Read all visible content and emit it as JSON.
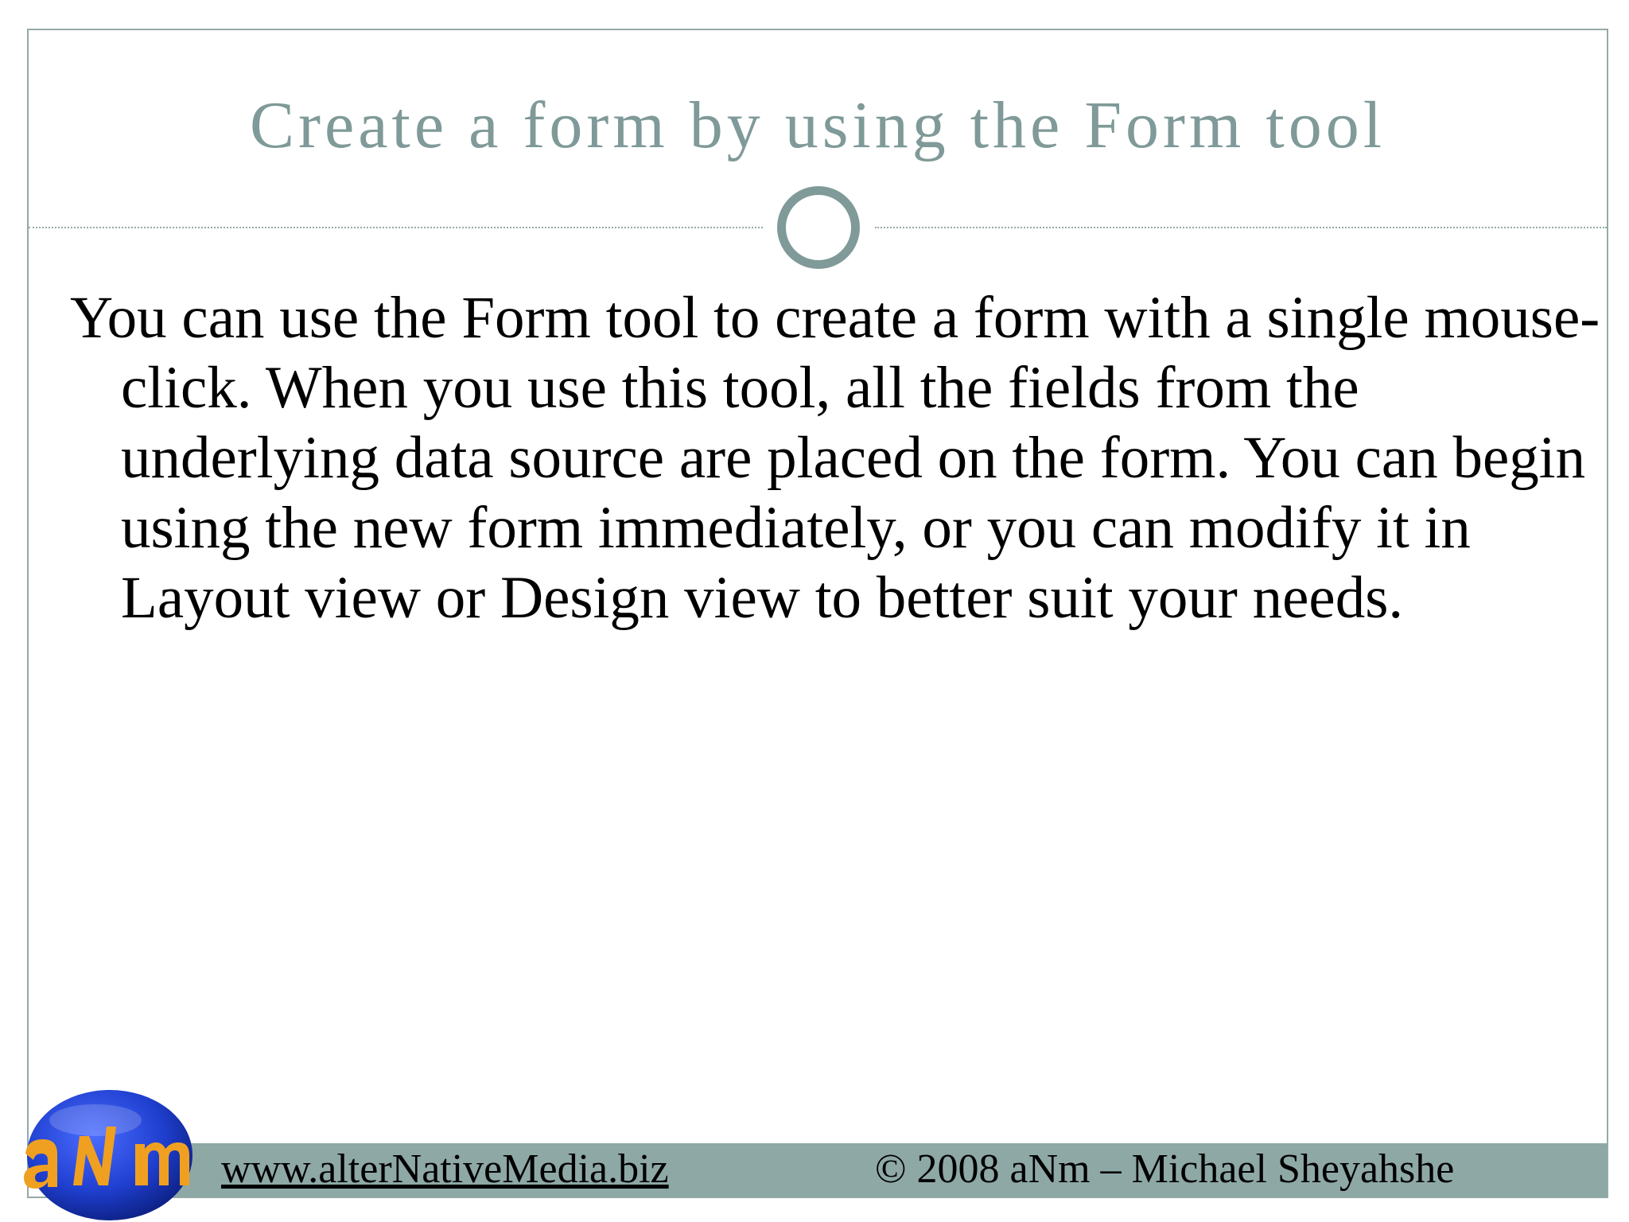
{
  "slide": {
    "title": "Create a form by using the Form tool",
    "body": "You can use the Form tool to create a form with a single mouse-click. When you use this tool, all the fields from the underlying data source are placed on the form. You can begin using the new form immediately, or you can modify it in Layout view or Design view to better suit your needs."
  },
  "footer": {
    "link_text": "www.alterNativeMedia.biz",
    "copyright": "© 2008 aNm – Michael Sheyahshe",
    "logo_text": "aNm"
  },
  "colors": {
    "accent": "#7f9a98",
    "footer_bar": "#8ea8a6",
    "logo_blue": "#1f3fcf",
    "logo_orange": "#f0a020"
  }
}
